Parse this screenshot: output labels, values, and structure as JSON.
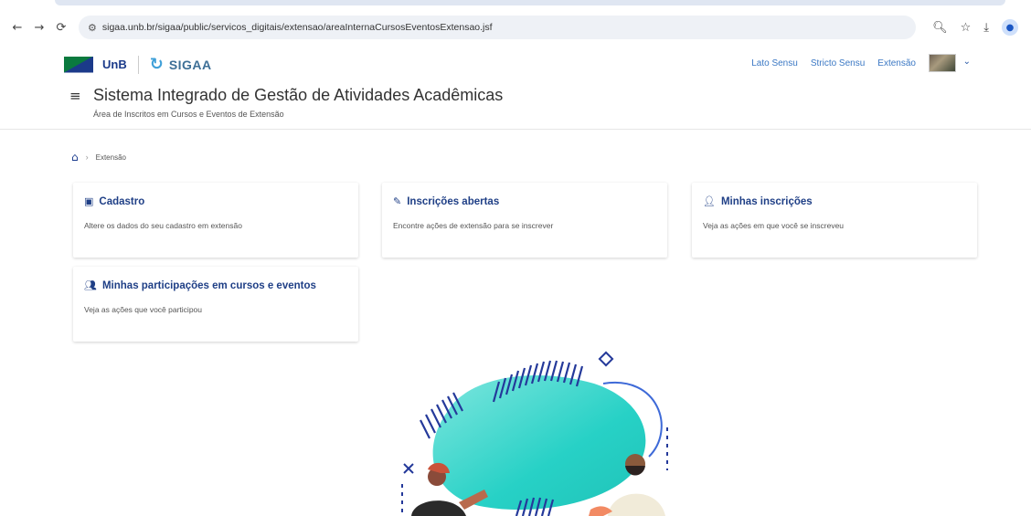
{
  "browser": {
    "url": "sigaa.unb.br/sigaa/public/servicos_digitais/extensao/areaInternaCursosEventosExtensao.jsf"
  },
  "header": {
    "logo_unb": "UnB",
    "logo_sigaa": "SIGAA",
    "links": [
      "Lato Sensu",
      "Stricto Sensu",
      "Extensão"
    ],
    "title": "Sistema Integrado de Gestão de Atividades Acadêmicas",
    "subtitle": "Área de Inscritos em Cursos e Eventos de Extensão"
  },
  "breadcrumb": {
    "current": "Extensão"
  },
  "cards": [
    {
      "icon": "id-card-icon",
      "title": "Cadastro",
      "description": "Altere os dados do seu cadastro em extensão"
    },
    {
      "icon": "pen-doc-icon",
      "title": "Inscrições abertas",
      "description": "Encontre ações de extensão para se inscrever"
    },
    {
      "icon": "user-edit-icon",
      "title": "Minhas inscrições",
      "description": "Veja as ações em que você se inscreveu"
    },
    {
      "icon": "users-icon",
      "title": "Minhas participações em cursos e eventos",
      "description": "Veja as ações que você participou"
    }
  ],
  "colors": {
    "primary": "#1f3f86",
    "link": "#3b78c4",
    "teal": "#2fd3c8"
  }
}
